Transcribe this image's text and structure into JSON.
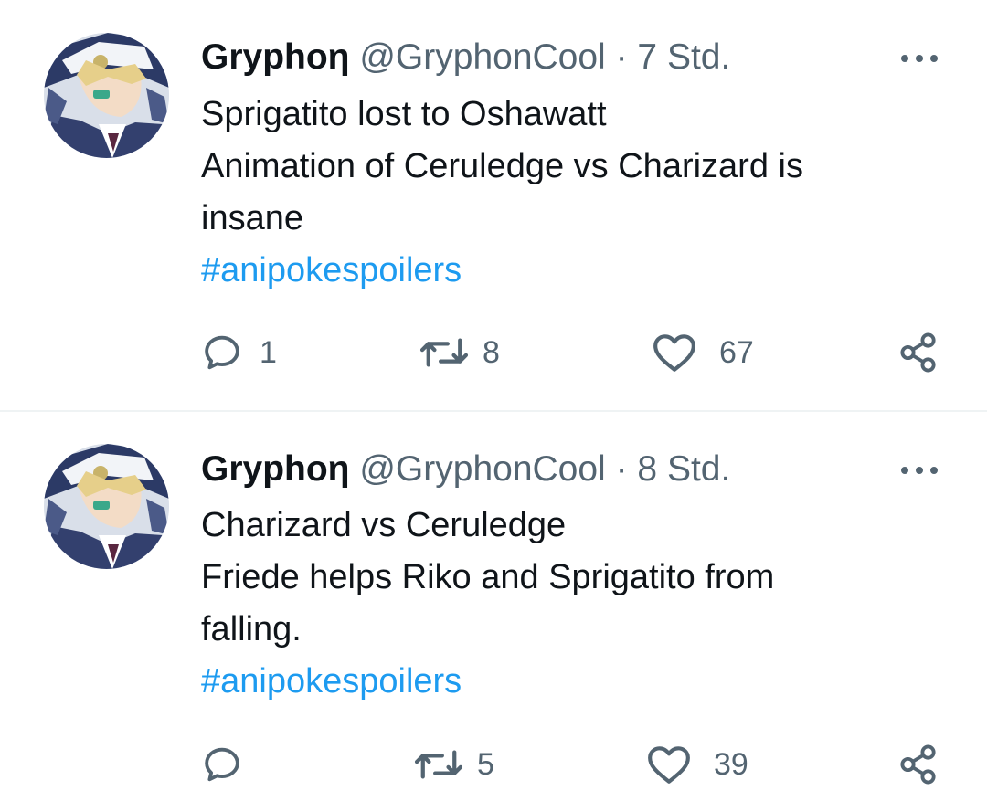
{
  "tweets": [
    {
      "name": "Gryphoη",
      "handle": "@GryphonCool",
      "separator": "·",
      "time": "7 Std.",
      "lines": [
        "Sprigatito lost to Oshawatt",
        "Animation of Ceruledge vs Charizard is",
        "insane"
      ],
      "hashtag": "#anipokespoilers",
      "replies": "1",
      "retweets": "8",
      "likes": "67"
    },
    {
      "name": "Gryphoη",
      "handle": "@GryphonCool",
      "separator": "·",
      "time": "8 Std.",
      "lines": [
        "Charizard vs Ceruledge",
        "Friede helps Riko and Sprigatito from",
        "falling."
      ],
      "hashtag": "#anipokespoilers",
      "replies": "",
      "retweets": "5",
      "likes": "39"
    }
  ],
  "icons": {
    "reply": "reply-icon",
    "retweet": "retweet-icon",
    "like": "heart-icon",
    "share": "share-icon",
    "more": "more-icon"
  },
  "colors": {
    "text": "#0f1419",
    "secondary": "#536471",
    "hashtag": "#1d9bf0",
    "divider": "#eff3f4"
  }
}
